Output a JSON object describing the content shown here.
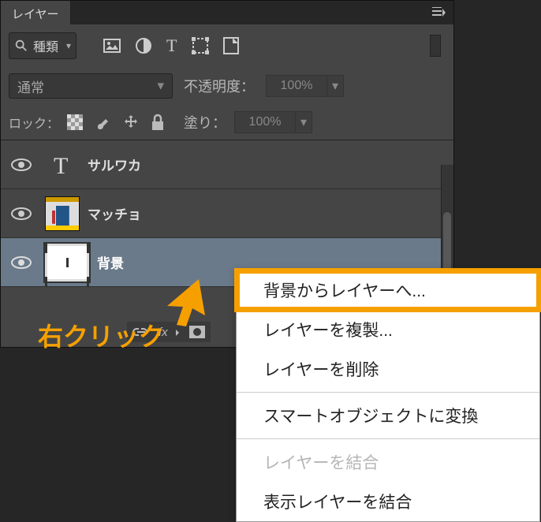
{
  "panel": {
    "tab": "レイヤー",
    "filter_label": "種類",
    "blend_mode": "通常",
    "opacity_label": "不透明度：",
    "opacity_value": "100%",
    "lock_label": "ロック：",
    "fill_label": "塗り：",
    "fill_value": "100%"
  },
  "layers": [
    {
      "name": "サルワカ",
      "type": "text"
    },
    {
      "name": "マッチョ",
      "type": "image"
    },
    {
      "name": "背景",
      "type": "bg"
    }
  ],
  "context_menu": {
    "items": [
      {
        "label": "背景からレイヤーへ...",
        "highlight": true
      },
      {
        "label": "レイヤーを複製..."
      },
      {
        "label": "レイヤーを削除"
      },
      {
        "sep": true
      },
      {
        "label": "スマートオブジェクトに変換"
      },
      {
        "sep": true
      },
      {
        "label": "レイヤーを結合",
        "disabled": true
      },
      {
        "label": "表示レイヤーを結合"
      }
    ]
  },
  "annotation": "右クリック"
}
